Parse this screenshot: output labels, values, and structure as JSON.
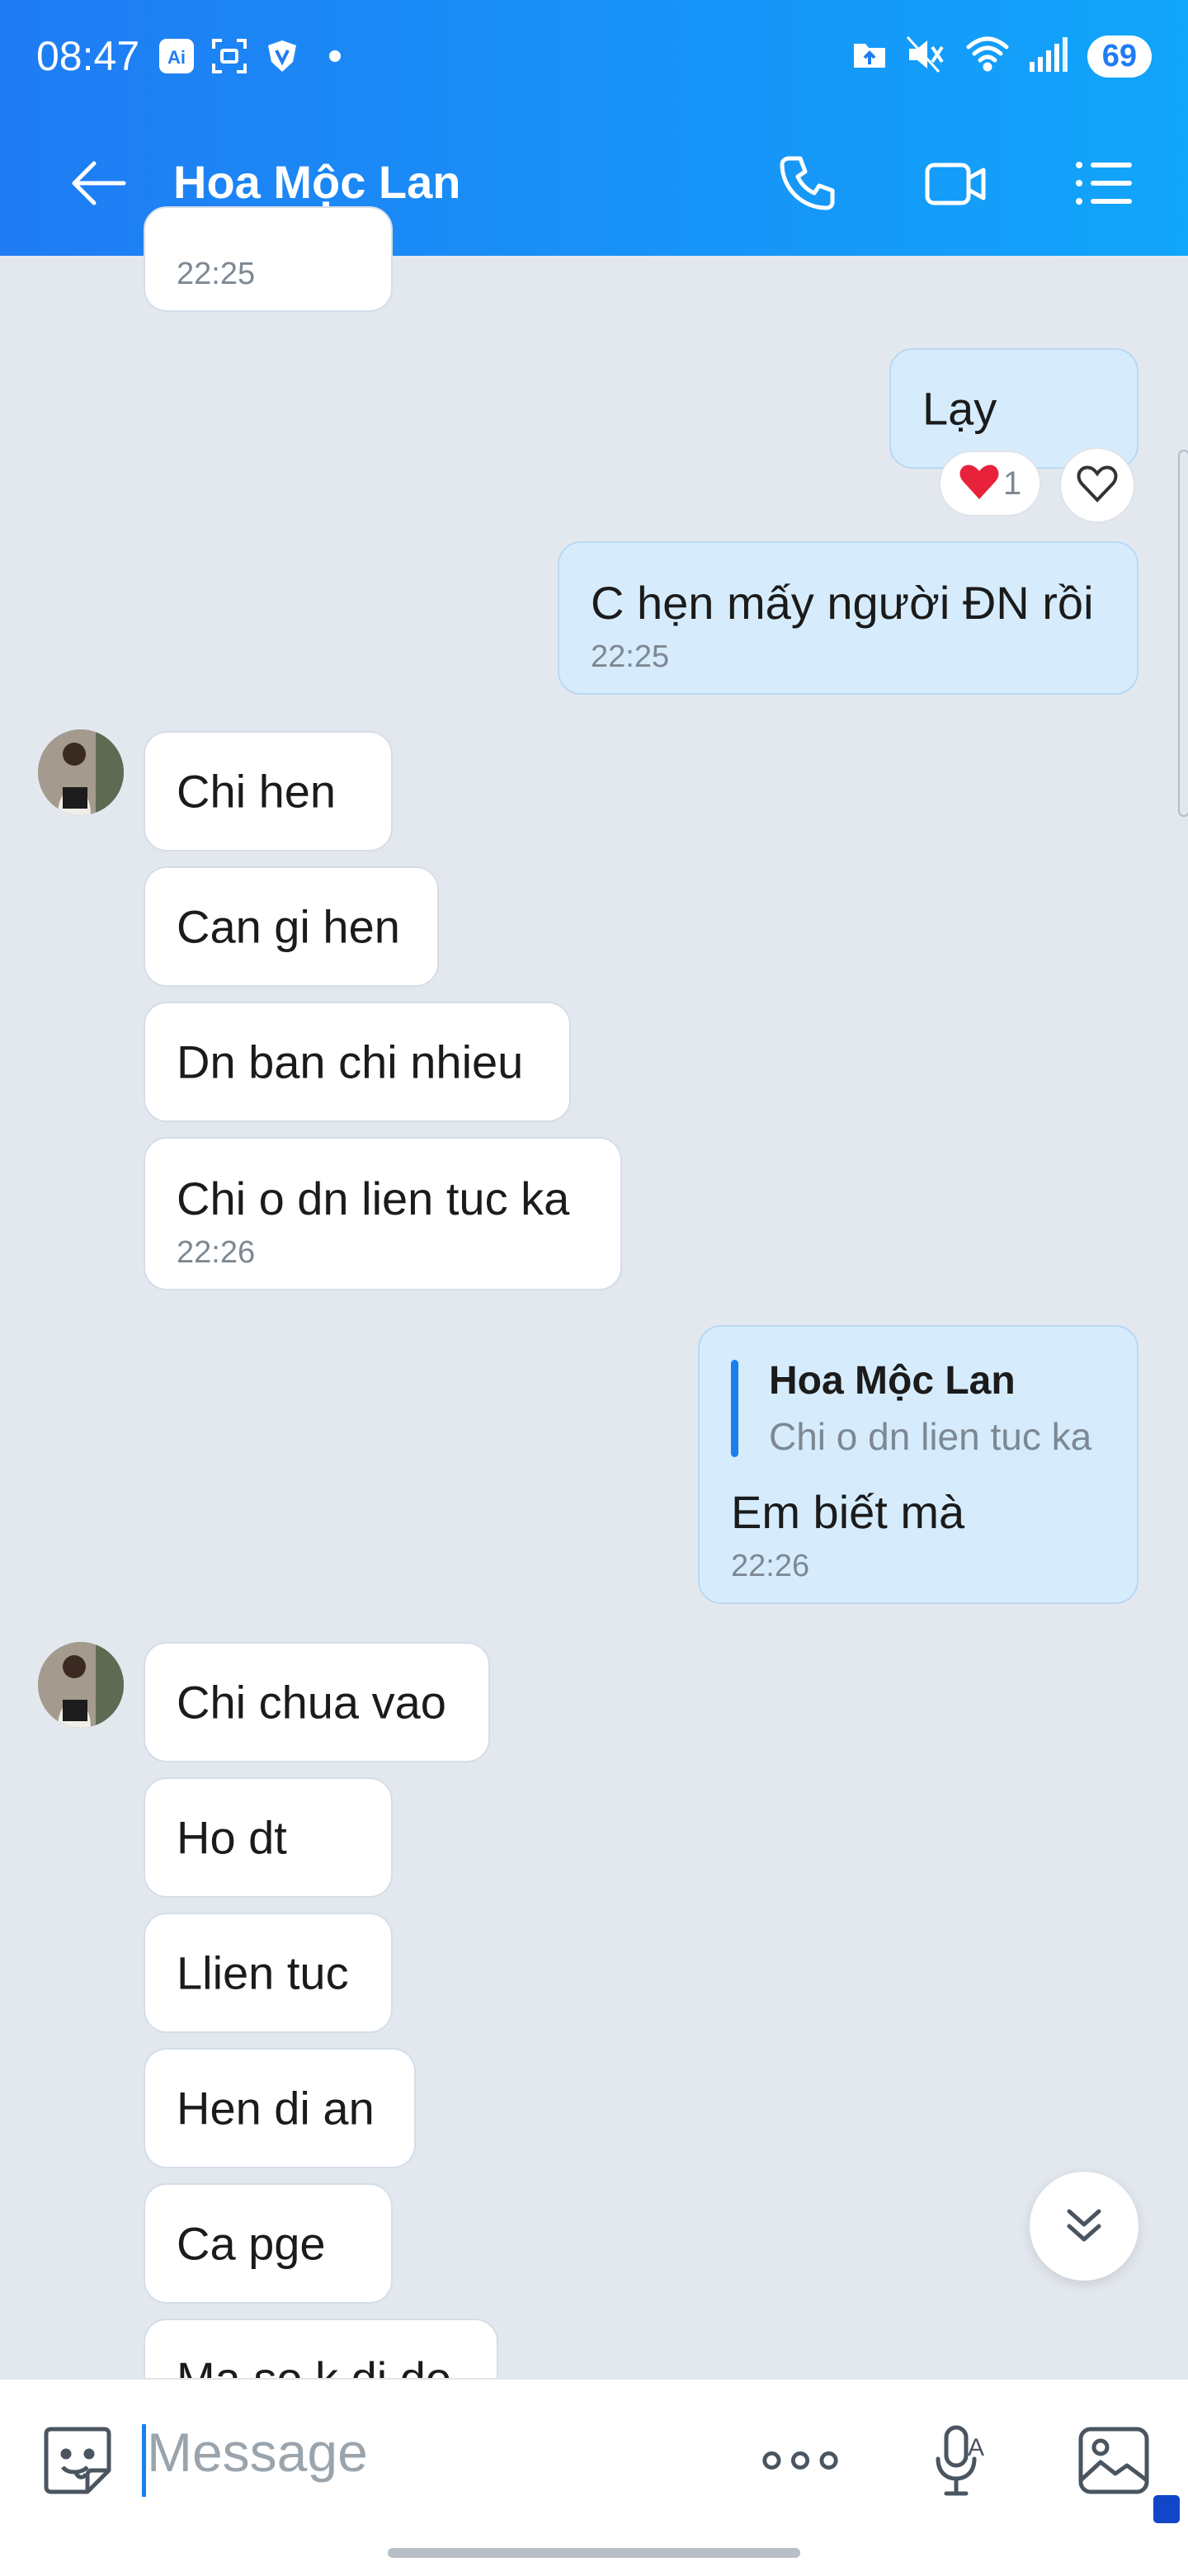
{
  "status_bar": {
    "time": "08:47",
    "icons_left": [
      "ai-icon",
      "scan-icon",
      "vpn-icon",
      "dot-icon"
    ],
    "icons_right": [
      "folder-upload-icon",
      "mute-icon",
      "wifi-icon",
      "signal-icon"
    ],
    "battery": "69"
  },
  "header": {
    "title": "Hoa Mộc Lan",
    "actions": [
      "phone-icon",
      "video-icon",
      "menu-list-icon"
    ]
  },
  "messages": [
    {
      "side": "contact",
      "text": "",
      "time": "22:25"
    },
    {
      "side": "me",
      "text": "Lạy",
      "reaction": {
        "emoji": "❤",
        "count": "1"
      }
    },
    {
      "side": "me",
      "text": "C hẹn mấy người ĐN rồi",
      "time": "22:25"
    },
    {
      "side": "contact",
      "text": "Chi hen"
    },
    {
      "side": "contact",
      "text": "Can gi hen"
    },
    {
      "side": "contact",
      "text": "Dn ban chi nhieu"
    },
    {
      "side": "contact",
      "text": "Chi o dn lien tuc ka",
      "time": "22:26"
    },
    {
      "side": "me",
      "reply_to": {
        "name": "Hoa Mộc Lan",
        "text": "Chi o dn lien tuc ka"
      },
      "text": "Em biết mà",
      "time": "22:26"
    },
    {
      "side": "contact",
      "text": "Chi chua vao"
    },
    {
      "side": "contact",
      "text": "Ho dt"
    },
    {
      "side": "contact",
      "text": "Llien tuc"
    },
    {
      "side": "contact",
      "text": "Hen di an"
    },
    {
      "side": "contact",
      "text": "Ca pge"
    },
    {
      "side": "contact",
      "text": "Ma so k di do"
    }
  ],
  "composer": {
    "placeholder": "Message"
  },
  "colors": {
    "header_start": "#1f7cf3",
    "header_end": "#11a5fb",
    "chat_bg": "#e3e8ef",
    "my_bubble": "#d6ecfd",
    "accent": "#1b7ff0"
  }
}
